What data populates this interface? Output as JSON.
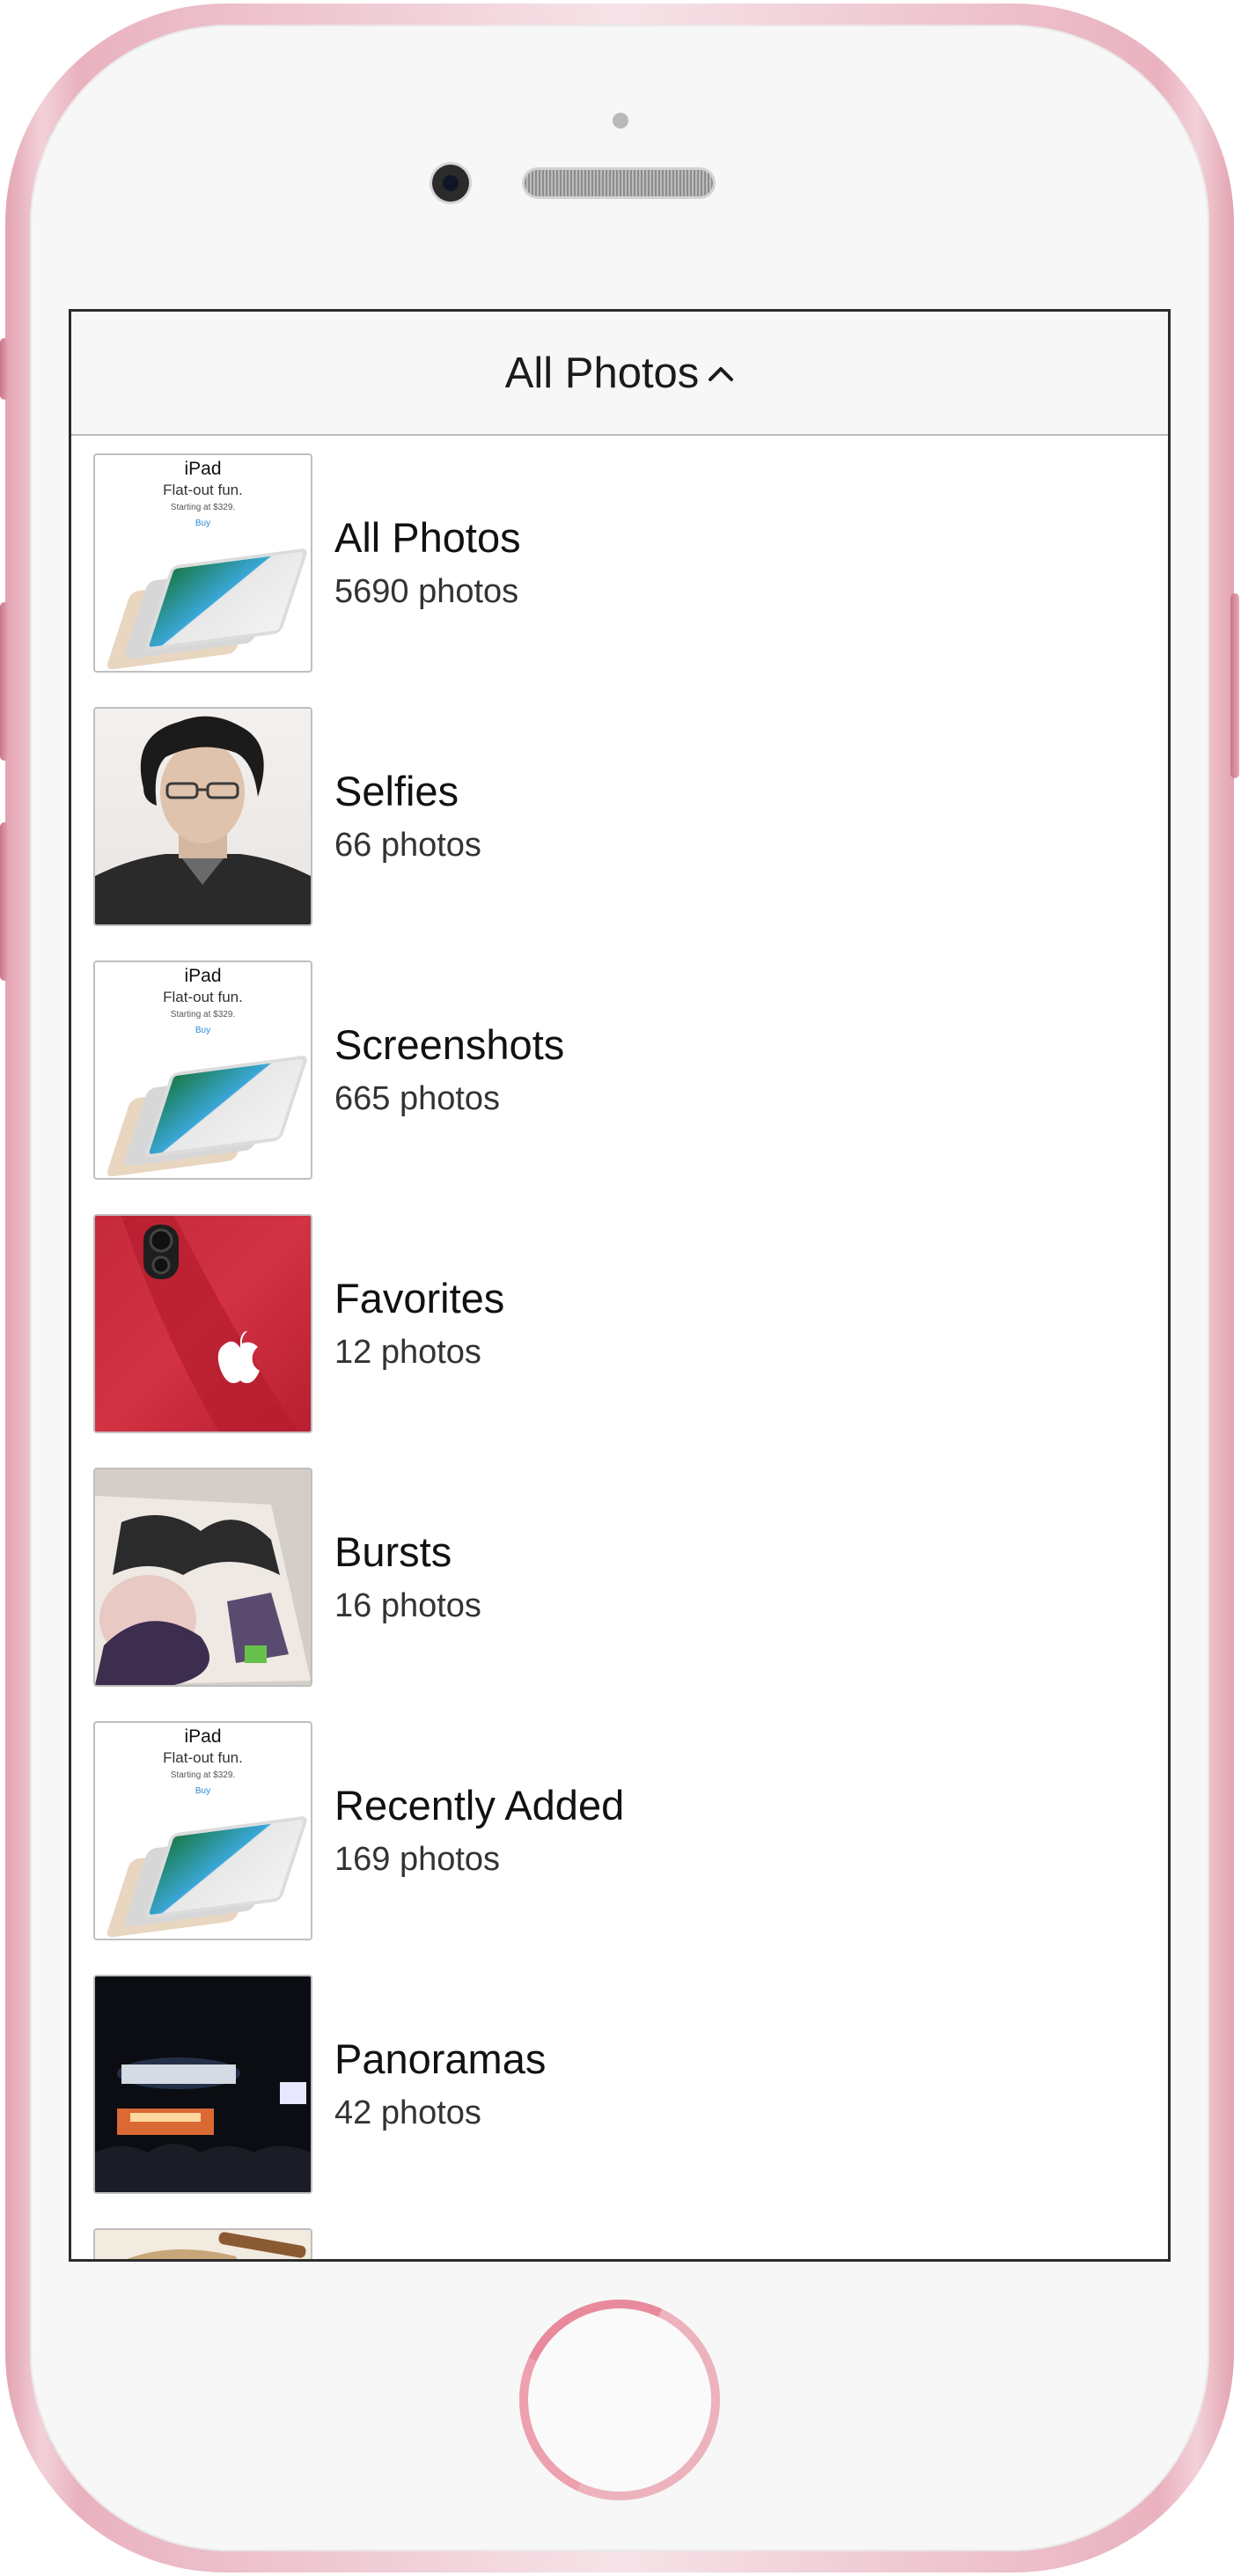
{
  "header": {
    "title": "All Photos",
    "title_icon": "chevron-up-icon"
  },
  "albums": [
    {
      "name": "All Photos",
      "count": "5690 photos",
      "thumbnail": "ipad-ad"
    },
    {
      "name": "Selfies",
      "count": "66 photos",
      "thumbnail": "selfie-portrait"
    },
    {
      "name": "Screenshots",
      "count": "665 photos",
      "thumbnail": "ipad-ad"
    },
    {
      "name": "Favorites",
      "count": "12 photos",
      "thumbnail": "red-iphone"
    },
    {
      "name": "Bursts",
      "count": "16 photos",
      "thumbnail": "burst-photo"
    },
    {
      "name": "Recently Added",
      "count": "169 photos",
      "thumbnail": "ipad-ad"
    },
    {
      "name": "Panoramas",
      "count": "42 photos",
      "thumbnail": "concert-night"
    },
    {
      "name": "",
      "count": "",
      "thumbnail": "food"
    }
  ],
  "ipad_ad": {
    "title": "iPad",
    "tagline": "Flat-out fun.",
    "price": "Starting at $329.",
    "buy": "Buy"
  },
  "colors": {
    "device_frame": "#e9b2bf",
    "home_ring": "#ecb3bc",
    "favorites_red": "#c52a3a"
  }
}
